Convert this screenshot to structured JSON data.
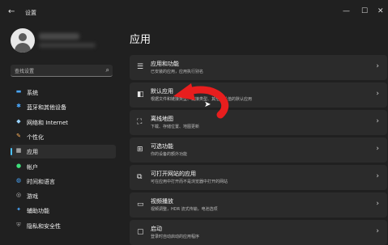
{
  "window": {
    "title": "设置",
    "back_icon": "←",
    "min_icon": "—",
    "max_icon": "☐",
    "close_icon": "✕"
  },
  "sidebar": {
    "search_placeholder": "查找设置",
    "search_icon": "⌕",
    "items": [
      {
        "label": "系统",
        "icon": "monitor-icon",
        "glyph": "▬",
        "color": "#4aa8ff",
        "active": false
      },
      {
        "label": "蓝牙和其他设备",
        "icon": "bluetooth-icon",
        "glyph": "✱",
        "color": "#4aa8ff",
        "active": false
      },
      {
        "label": "网络和 Internet",
        "icon": "wifi-icon",
        "glyph": "◆",
        "color": "#9ad4ff",
        "active": false
      },
      {
        "label": "个性化",
        "icon": "brush-icon",
        "glyph": "✎",
        "color": "#ffb35c",
        "active": false
      },
      {
        "label": "应用",
        "icon": "apps-icon",
        "glyph": "▦",
        "color": "#d8d8d8",
        "active": true
      },
      {
        "label": "帐户",
        "icon": "person-icon",
        "glyph": "●",
        "color": "#3ee07a",
        "active": false
      },
      {
        "label": "时间和语言",
        "icon": "globe-clock-icon",
        "glyph": "◍",
        "color": "#4aa8ff",
        "active": false
      },
      {
        "label": "游戏",
        "icon": "gamepad-icon",
        "glyph": "◎",
        "color": "#bfbfbf",
        "active": false
      },
      {
        "label": "辅助功能",
        "icon": "accessibility-icon",
        "glyph": "✦",
        "color": "#4aa8ff",
        "active": false
      },
      {
        "label": "隐私和安全性",
        "icon": "shield-icon",
        "glyph": "⛨",
        "color": "#9a9a9a",
        "active": false
      }
    ]
  },
  "main": {
    "title": "应用",
    "cards": [
      {
        "title": "应用和功能",
        "subtitle": "已安装的应用，应用执行别名",
        "icon": "apps-list-icon",
        "glyph": "☰"
      },
      {
        "title": "默认应用",
        "subtitle": "根据文件和链接类型、链接类型、其他默认值的默认应用",
        "icon": "default-apps-icon",
        "glyph": "◧"
      },
      {
        "title": "离线地图",
        "subtitle": "下载、存储位置、地图更新",
        "icon": "map-icon",
        "glyph": "⛶"
      },
      {
        "title": "可选功能",
        "subtitle": "你的设备的额外功能",
        "icon": "optional-features-icon",
        "glyph": "⊞"
      },
      {
        "title": "可打开网站的应用",
        "subtitle": "可在应用中打开而不是浏览器中打开的网站",
        "icon": "web-apps-icon",
        "glyph": "⧉"
      },
      {
        "title": "视频播放",
        "subtitle": "视频调整，HDR 流式传输，电池选项",
        "icon": "video-icon",
        "glyph": "▭"
      },
      {
        "title": "启动",
        "subtitle": "登录时自动启动的应用程序",
        "icon": "startup-icon",
        "glyph": "▢"
      }
    ],
    "chevron": "›"
  },
  "annotation": {
    "arrow_color": "#e81e1e"
  }
}
